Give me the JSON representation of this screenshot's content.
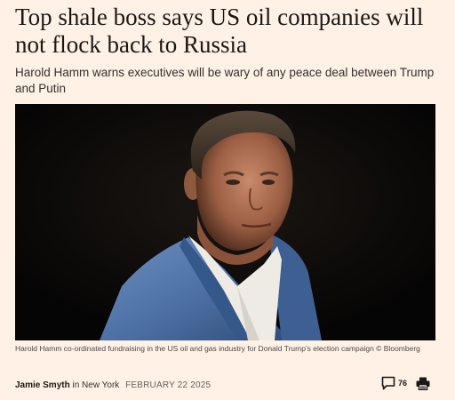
{
  "article": {
    "headline": "Top shale boss says US oil companies will not flock back to Russia",
    "standfirst": "Harold Hamm warns executives will be wary of any peace deal between Trump and Putin",
    "image_caption": "Harold Hamm co-ordinated fundraising in the US oil and gas industry for Donald Trump’s election campaign © Bloomberg"
  },
  "byline": {
    "author": "Jamie Smyth",
    "location_prefix": " in ",
    "location": "New York",
    "date": "FEBRUARY 22 2025"
  },
  "actions": {
    "comment_icon": "speech-bubble-icon",
    "comment_count": "76",
    "print_icon": "printer-icon"
  },
  "colors": {
    "page_background": "#fff1e5",
    "headline": "#1a1817",
    "photo_background": "#0a0908"
  }
}
